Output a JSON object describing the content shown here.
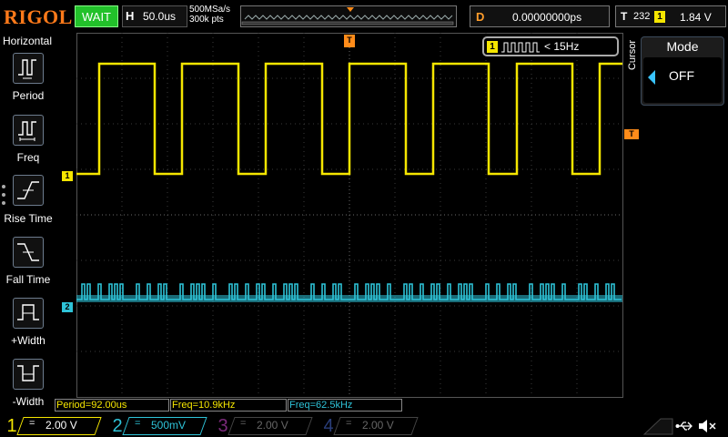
{
  "brand": "RIGOL",
  "run_status": "WAIT",
  "horizontal": {
    "label": "H",
    "timebase": "50.0us"
  },
  "acquisition": {
    "sample_rate": "500MSa/s",
    "memory_depth": "300k pts"
  },
  "delay": {
    "label": "D",
    "value": "0.00000000ps"
  },
  "trigger": {
    "label": "T",
    "channel": "1",
    "level": "1.84 V",
    "count": "232"
  },
  "left_menu": {
    "title": "Horizontal",
    "items": [
      "Period",
      "Freq",
      "Rise Time",
      "Fall Time",
      "+Width",
      "-Width"
    ]
  },
  "cursor_panel": {
    "tab_label": "Cursor",
    "mode_title": "Mode",
    "mode_value": "OFF"
  },
  "freq_counter": {
    "channel": "1",
    "text": "< 15Hz"
  },
  "markers": {
    "ch1": "1",
    "ch2": "2",
    "trigger": "T",
    "time_origin": "T"
  },
  "measurements": [
    {
      "text": "Period=92.00us",
      "color": "#f5e600"
    },
    {
      "text": "Freq=10.9kHz",
      "color": "#f5e600"
    },
    {
      "text": "Freq=62.5kHz",
      "color": "#2ec3d8"
    }
  ],
  "channels": [
    {
      "num": "1",
      "coupling": "=",
      "scale": "2.00 V",
      "color": "#f5e600",
      "active": true
    },
    {
      "num": "2",
      "coupling": "=",
      "scale": "500mV",
      "color": "#2ec3d8",
      "active": true
    },
    {
      "num": "3",
      "coupling": "=",
      "scale": "2.00 V",
      "color": "#c23ac2",
      "active": false
    },
    {
      "num": "4",
      "coupling": "=",
      "scale": "2.00 V",
      "color": "#3a5cc2",
      "active": false
    }
  ],
  "colors": {
    "ch1": "#f5e600",
    "ch2": "#2ec3d8",
    "trigger": "#ff8c1a",
    "brand": "#ff7a1a",
    "wait_bg": "#22c12a"
  },
  "icons": [
    "period-icon",
    "freq-icon",
    "rise-time-icon",
    "fall-time-icon",
    "pos-width-icon",
    "neg-width-icon",
    "usb-icon",
    "speaker-mute-icon"
  ]
}
